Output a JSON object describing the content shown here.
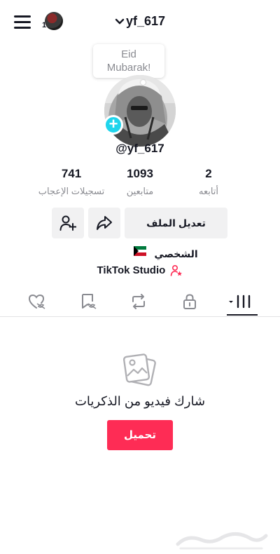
{
  "top_bar": {
    "username": "yf_617",
    "notification_count": "1"
  },
  "bubble": {
    "line1": "Eid",
    "line2": "Mubarak!"
  },
  "profile": {
    "handle": "@yf_617"
  },
  "stats": {
    "likes": {
      "value": "741",
      "label": "تسجيلات الإعجاب"
    },
    "followers": {
      "value": "1093",
      "label": "متابعين"
    },
    "following": {
      "value": "2",
      "label": "أتابعه"
    }
  },
  "buttons": {
    "edit_profile": "تعديل الملف الشخصي"
  },
  "country_flag": "kuwait-flag",
  "studio": {
    "label": "TikTok Studio"
  },
  "tabs": [
    "liked-icon",
    "saved-icon",
    "repost-icon",
    "private-lock-icon",
    "videos-grid-icon"
  ],
  "empty_state": {
    "message": "شارك فيديو من الذكريات",
    "upload_label": "تحميل"
  },
  "colors": {
    "accent_red": "#fe2c55",
    "badge_cyan": "#20d5ec",
    "studio_pink": "#fe2c55"
  }
}
